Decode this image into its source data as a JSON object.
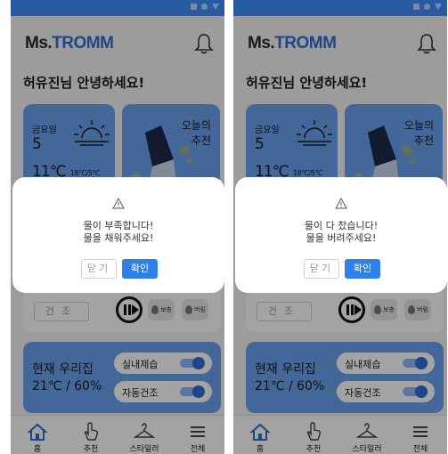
{
  "app": {
    "brand_prefix": "Ms.",
    "brand_name": "TROMM",
    "greeting": "허유진님 안녕하세요!"
  },
  "weather": {
    "day": "금요일",
    "date": "5",
    "temperature": "11℃",
    "range": "18℃/5℃"
  },
  "recommendation": {
    "line1": "오늘의",
    "line2": "추천"
  },
  "controls": {
    "dry_label": "건조",
    "refill_label": "보충",
    "drain_label": "버림"
  },
  "home_status": {
    "label": "현재 우리집",
    "value": "21℃ / 60%",
    "toggle_dehumidify": "실내제습",
    "toggle_autodry": "자동건조"
  },
  "tabs": [
    "홈",
    "추천",
    "스타일러",
    "전체"
  ],
  "dialogs": [
    {
      "line1": "물이 부족합니다!",
      "line2": "물을 채워주세요!",
      "close_label": "닫기",
      "ok_label": "확인"
    },
    {
      "line1": "물이 다 찼습니다!",
      "line2": "물을 버려주세요!",
      "close_label": "닫기",
      "ok_label": "확인"
    }
  ],
  "colors": {
    "accent": "#3d8fff",
    "card": "#6aa2ee",
    "button": "#2f7fe9"
  }
}
